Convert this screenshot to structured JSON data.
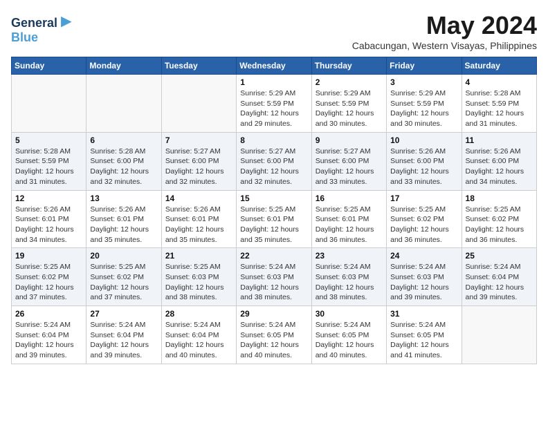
{
  "logo": {
    "line1": "General",
    "line2": "Blue"
  },
  "title": "May 2024",
  "subtitle": "Cabacungan, Western Visayas, Philippines",
  "days_of_week": [
    "Sunday",
    "Monday",
    "Tuesday",
    "Wednesday",
    "Thursday",
    "Friday",
    "Saturday"
  ],
  "weeks": [
    [
      {
        "day": "",
        "info": ""
      },
      {
        "day": "",
        "info": ""
      },
      {
        "day": "",
        "info": ""
      },
      {
        "day": "1",
        "info": "Sunrise: 5:29 AM\nSunset: 5:59 PM\nDaylight: 12 hours and 29 minutes."
      },
      {
        "day": "2",
        "info": "Sunrise: 5:29 AM\nSunset: 5:59 PM\nDaylight: 12 hours and 30 minutes."
      },
      {
        "day": "3",
        "info": "Sunrise: 5:29 AM\nSunset: 5:59 PM\nDaylight: 12 hours and 30 minutes."
      },
      {
        "day": "4",
        "info": "Sunrise: 5:28 AM\nSunset: 5:59 PM\nDaylight: 12 hours and 31 minutes."
      }
    ],
    [
      {
        "day": "5",
        "info": "Sunrise: 5:28 AM\nSunset: 5:59 PM\nDaylight: 12 hours and 31 minutes."
      },
      {
        "day": "6",
        "info": "Sunrise: 5:28 AM\nSunset: 6:00 PM\nDaylight: 12 hours and 32 minutes."
      },
      {
        "day": "7",
        "info": "Sunrise: 5:27 AM\nSunset: 6:00 PM\nDaylight: 12 hours and 32 minutes."
      },
      {
        "day": "8",
        "info": "Sunrise: 5:27 AM\nSunset: 6:00 PM\nDaylight: 12 hours and 32 minutes."
      },
      {
        "day": "9",
        "info": "Sunrise: 5:27 AM\nSunset: 6:00 PM\nDaylight: 12 hours and 33 minutes."
      },
      {
        "day": "10",
        "info": "Sunrise: 5:26 AM\nSunset: 6:00 PM\nDaylight: 12 hours and 33 minutes."
      },
      {
        "day": "11",
        "info": "Sunrise: 5:26 AM\nSunset: 6:00 PM\nDaylight: 12 hours and 34 minutes."
      }
    ],
    [
      {
        "day": "12",
        "info": "Sunrise: 5:26 AM\nSunset: 6:01 PM\nDaylight: 12 hours and 34 minutes."
      },
      {
        "day": "13",
        "info": "Sunrise: 5:26 AM\nSunset: 6:01 PM\nDaylight: 12 hours and 35 minutes."
      },
      {
        "day": "14",
        "info": "Sunrise: 5:26 AM\nSunset: 6:01 PM\nDaylight: 12 hours and 35 minutes."
      },
      {
        "day": "15",
        "info": "Sunrise: 5:25 AM\nSunset: 6:01 PM\nDaylight: 12 hours and 35 minutes."
      },
      {
        "day": "16",
        "info": "Sunrise: 5:25 AM\nSunset: 6:01 PM\nDaylight: 12 hours and 36 minutes."
      },
      {
        "day": "17",
        "info": "Sunrise: 5:25 AM\nSunset: 6:02 PM\nDaylight: 12 hours and 36 minutes."
      },
      {
        "day": "18",
        "info": "Sunrise: 5:25 AM\nSunset: 6:02 PM\nDaylight: 12 hours and 36 minutes."
      }
    ],
    [
      {
        "day": "19",
        "info": "Sunrise: 5:25 AM\nSunset: 6:02 PM\nDaylight: 12 hours and 37 minutes."
      },
      {
        "day": "20",
        "info": "Sunrise: 5:25 AM\nSunset: 6:02 PM\nDaylight: 12 hours and 37 minutes."
      },
      {
        "day": "21",
        "info": "Sunrise: 5:25 AM\nSunset: 6:03 PM\nDaylight: 12 hours and 38 minutes."
      },
      {
        "day": "22",
        "info": "Sunrise: 5:24 AM\nSunset: 6:03 PM\nDaylight: 12 hours and 38 minutes."
      },
      {
        "day": "23",
        "info": "Sunrise: 5:24 AM\nSunset: 6:03 PM\nDaylight: 12 hours and 38 minutes."
      },
      {
        "day": "24",
        "info": "Sunrise: 5:24 AM\nSunset: 6:03 PM\nDaylight: 12 hours and 39 minutes."
      },
      {
        "day": "25",
        "info": "Sunrise: 5:24 AM\nSunset: 6:04 PM\nDaylight: 12 hours and 39 minutes."
      }
    ],
    [
      {
        "day": "26",
        "info": "Sunrise: 5:24 AM\nSunset: 6:04 PM\nDaylight: 12 hours and 39 minutes."
      },
      {
        "day": "27",
        "info": "Sunrise: 5:24 AM\nSunset: 6:04 PM\nDaylight: 12 hours and 39 minutes."
      },
      {
        "day": "28",
        "info": "Sunrise: 5:24 AM\nSunset: 6:04 PM\nDaylight: 12 hours and 40 minutes."
      },
      {
        "day": "29",
        "info": "Sunrise: 5:24 AM\nSunset: 6:05 PM\nDaylight: 12 hours and 40 minutes."
      },
      {
        "day": "30",
        "info": "Sunrise: 5:24 AM\nSunset: 6:05 PM\nDaylight: 12 hours and 40 minutes."
      },
      {
        "day": "31",
        "info": "Sunrise: 5:24 AM\nSunset: 6:05 PM\nDaylight: 12 hours and 41 minutes."
      },
      {
        "day": "",
        "info": ""
      }
    ]
  ]
}
